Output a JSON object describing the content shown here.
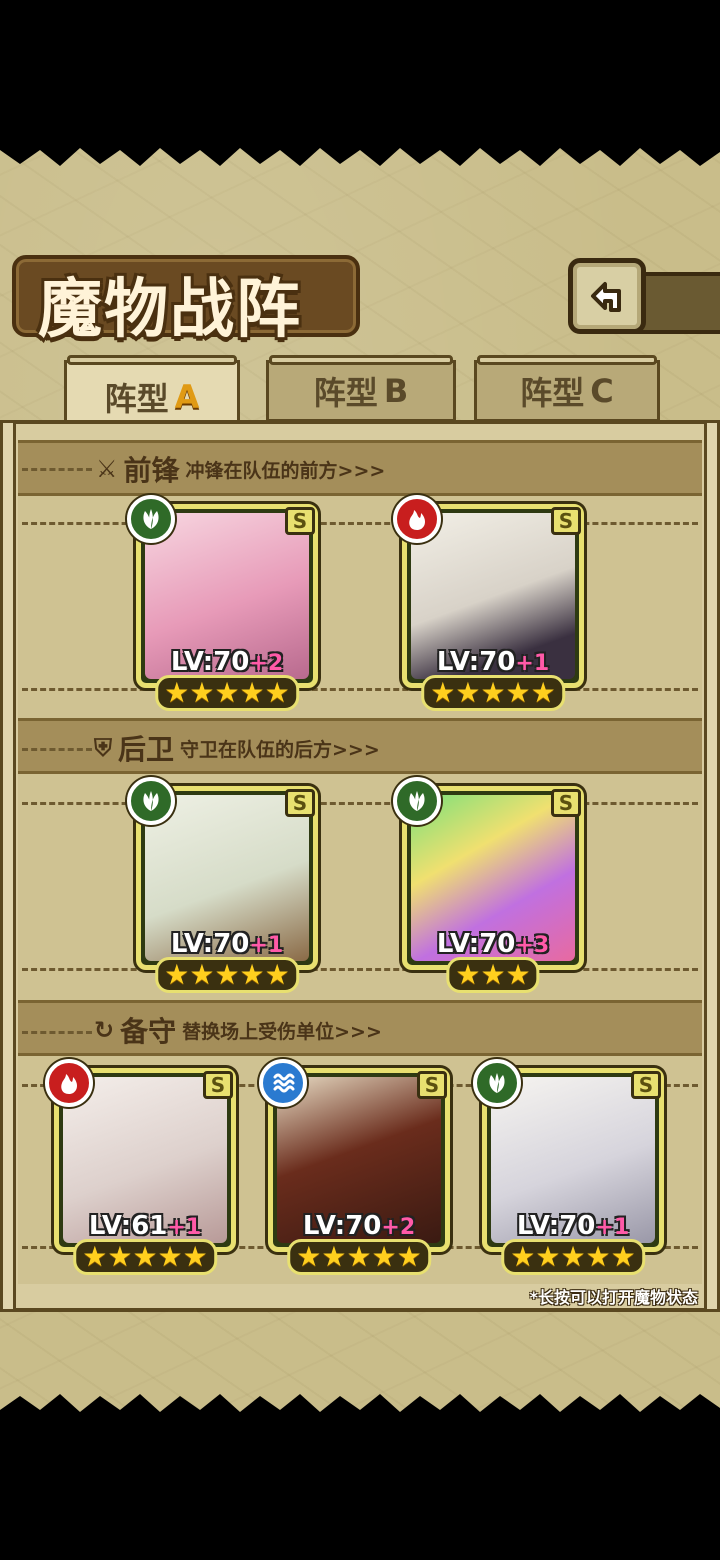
{
  "header": {
    "title": "魔物战阵"
  },
  "tabs": [
    {
      "prefix": "阵型",
      "letter": "A",
      "active": true
    },
    {
      "prefix": "阵型",
      "letter": "B",
      "active": false
    },
    {
      "prefix": "阵型",
      "letter": "C",
      "active": false
    }
  ],
  "sections": {
    "front": {
      "title": "前锋",
      "desc": "冲锋在队伍的前方>>>"
    },
    "back": {
      "title": "后卫",
      "desc": "守卫在队伍的后方>>>"
    },
    "reserve": {
      "title": "备守",
      "desc": "替换场上受伤单位>>>"
    }
  },
  "cards": {
    "front_1": {
      "element": "grass",
      "rank": "S",
      "lv": "LV:70",
      "plus": "+2",
      "stars": 5
    },
    "front_2": {
      "element": "fire",
      "rank": "S",
      "lv": "LV:70",
      "plus": "+1",
      "stars": 5
    },
    "back_1": {
      "element": "grass",
      "rank": "S",
      "lv": "LV:70",
      "plus": "+1",
      "stars": 5
    },
    "back_2": {
      "element": "grass",
      "rank": "S",
      "lv": "LV:70",
      "plus": "+3",
      "stars": 3
    },
    "reserve_1": {
      "element": "fire",
      "rank": "S",
      "lv": "LV:61",
      "plus": "+1",
      "stars": 5
    },
    "reserve_2": {
      "element": "water",
      "rank": "S",
      "lv": "LV:70",
      "plus": "+2",
      "stars": 5
    },
    "reserve_3": {
      "element": "grass",
      "rank": "S",
      "lv": "LV:70",
      "plus": "+1",
      "stars": 5
    }
  },
  "footer": {
    "hint": "*长按可以打开魔物状态"
  },
  "colors": {
    "card_border": "#e8e070",
    "star": "#ffcf1e",
    "level_plus": "#ff5aa8",
    "grass": "#2f6a28",
    "fire": "#c81e1e",
    "water": "#2a7ad0"
  }
}
